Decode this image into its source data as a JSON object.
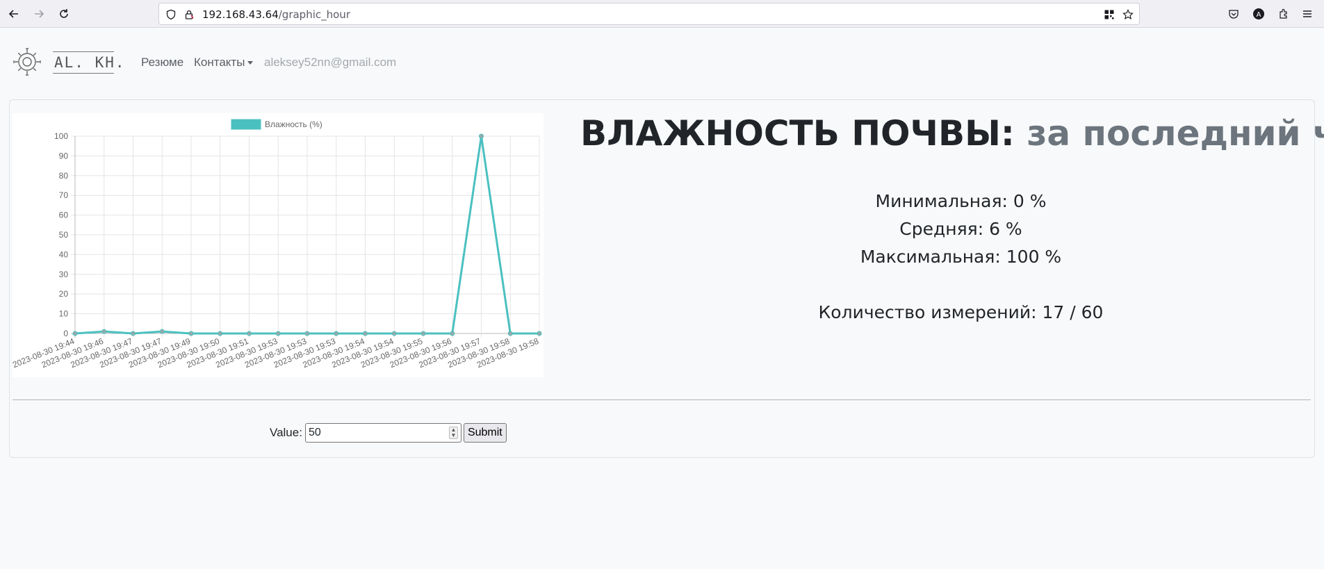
{
  "browser": {
    "url_host": "192.168.43.64",
    "url_path": "/graphic_hour",
    "icons": [
      "back-arrow-icon",
      "forward-arrow-icon",
      "reload-icon",
      "shield-icon",
      "lock-icon",
      "qr-code-icon",
      "star-icon",
      "pocket-icon",
      "account-icon",
      "extensions-icon",
      "menu-icon"
    ]
  },
  "nav": {
    "logo_text": "AL. KH.",
    "link_resume": "Резюме",
    "link_contacts": "Контакты",
    "email": "aleksey52nn@gmail.com"
  },
  "heading": {
    "main": "ВЛАЖНОСТЬ ПОЧВЫ:",
    "sub": "за последний час"
  },
  "stats": {
    "min": "Минимальная:  0 %",
    "avg": "Средняя:  6 %",
    "max": "Максимальная:  100 %",
    "count": "Количество измерений: 17 / 60"
  },
  "form": {
    "label": "Value:",
    "value": "50",
    "submit_label": "Submit"
  },
  "colors": {
    "series": "#4bc0c0",
    "series_fill": "#4bc0c0"
  },
  "chart_data": {
    "type": "line",
    "legend": "top",
    "grid": true,
    "ylim": [
      0,
      100
    ],
    "yticks": [
      0,
      10,
      20,
      30,
      40,
      50,
      60,
      70,
      80,
      90,
      100
    ],
    "x": [
      "2023-08-30 19:44",
      "2023-08-30 19:46",
      "2023-08-30 19:47",
      "2023-08-30 19:47",
      "2023-08-30 19:49",
      "2023-08-30 19:50",
      "2023-08-30 19:51",
      "2023-08-30 19:53",
      "2023-08-30 19:53",
      "2023-08-30 19:53",
      "2023-08-30 19:54",
      "2023-08-30 19:54",
      "2023-08-30 19:55",
      "2023-08-30 19:56",
      "2023-08-30 19:57",
      "2023-08-30 19:58",
      "2023-08-30 19:58"
    ],
    "series": [
      {
        "name": "Влажность (%)",
        "values": [
          0,
          1,
          0,
          1,
          0,
          0,
          0,
          0,
          0,
          0,
          0,
          0,
          0,
          0,
          100,
          0,
          0
        ]
      }
    ]
  }
}
